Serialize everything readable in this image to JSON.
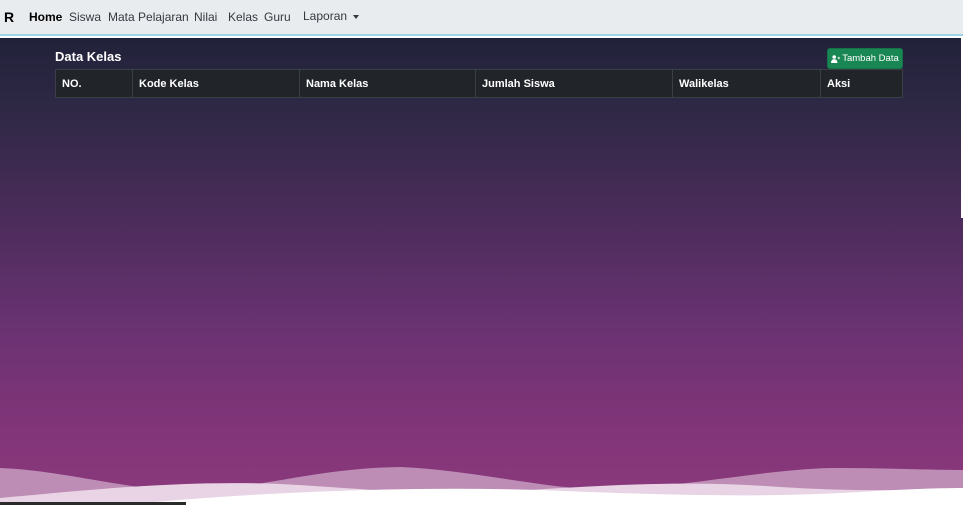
{
  "navbar": {
    "brand": "R",
    "items": [
      {
        "label": "Home",
        "active": true
      },
      {
        "label": "Siswa"
      },
      {
        "label": "Mata Pelajaran"
      },
      {
        "label": "Nilai"
      },
      {
        "label": "Kelas"
      },
      {
        "label": "Guru"
      }
    ],
    "dropdown_label": "Laporan"
  },
  "page": {
    "title": "Data Kelas",
    "add_button_label": "Tambah Data",
    "add_button_icon": "user-plus-icon"
  },
  "table": {
    "columns": [
      "NO.",
      "Kode Kelas",
      "Nama Kelas",
      "Jumlah Siswa",
      "Walikelas",
      "Aksi"
    ],
    "rows": []
  },
  "colors": {
    "navbar_bg": "#e9ecef",
    "gradient_top": "#22223a",
    "gradient_bottom": "#8a3a7c",
    "button_green": "#198754",
    "table_header_bg": "#212529"
  }
}
